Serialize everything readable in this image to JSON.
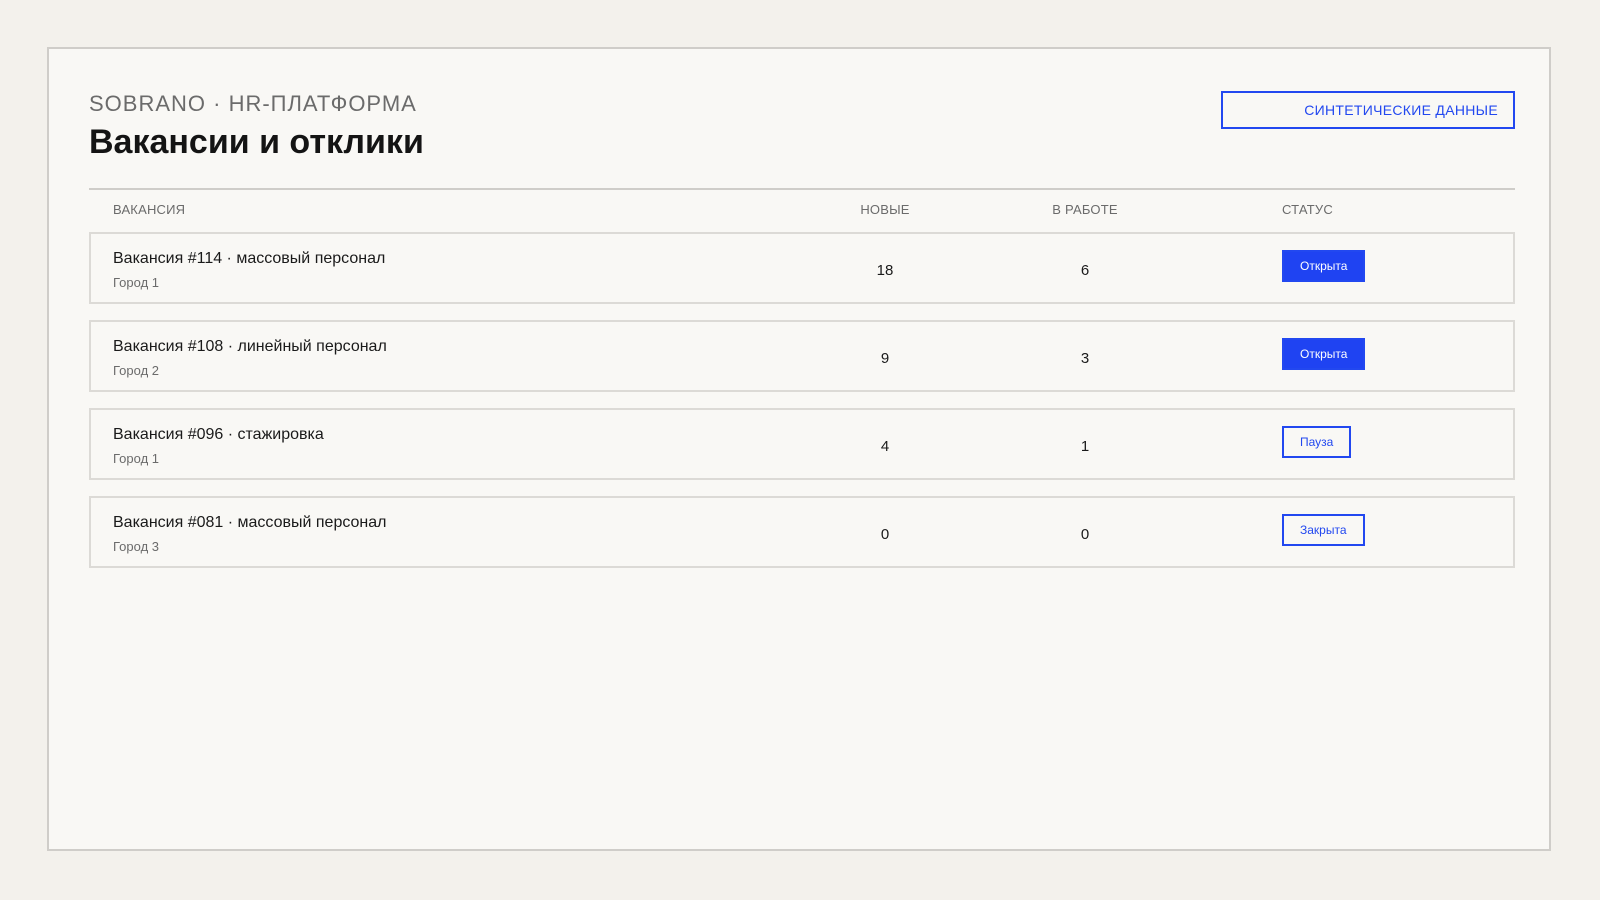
{
  "header": {
    "brand": "SOBRANO · HR-ПЛАТФОРМА",
    "title": "Вакансии и отклики",
    "synthetic_label": "СИНТЕТИЧЕСКИЕ ДАННЫЕ"
  },
  "table": {
    "columns": {
      "vacancy": "ВАКАНСИЯ",
      "new": "НОВЫЕ",
      "in_work": "В РАБОТЕ",
      "status": "СТАТУС"
    },
    "rows": [
      {
        "title": "Вакансия #114 · массовый персонал",
        "city": "Город 1",
        "new": "18",
        "in_work": "6",
        "status": "Открыта",
        "status_style": "filled"
      },
      {
        "title": "Вакансия #108 · линейный персонал",
        "city": "Город 2",
        "new": "9",
        "in_work": "3",
        "status": "Открыта",
        "status_style": "filled"
      },
      {
        "title": "Вакансия #096 · стажировка",
        "city": "Город 1",
        "new": "4",
        "in_work": "1",
        "status": "Пауза",
        "status_style": "outline"
      },
      {
        "title": "Вакансия #081 · массовый персонал",
        "city": "Город 3",
        "new": "0",
        "in_work": "0",
        "status": "Закрыта",
        "status_style": "outline"
      }
    ]
  },
  "colors": {
    "accent": "#1f43f2",
    "background": "#f3f1ec",
    "panel": "#f9f8f5",
    "border": "#cfcdc9"
  }
}
